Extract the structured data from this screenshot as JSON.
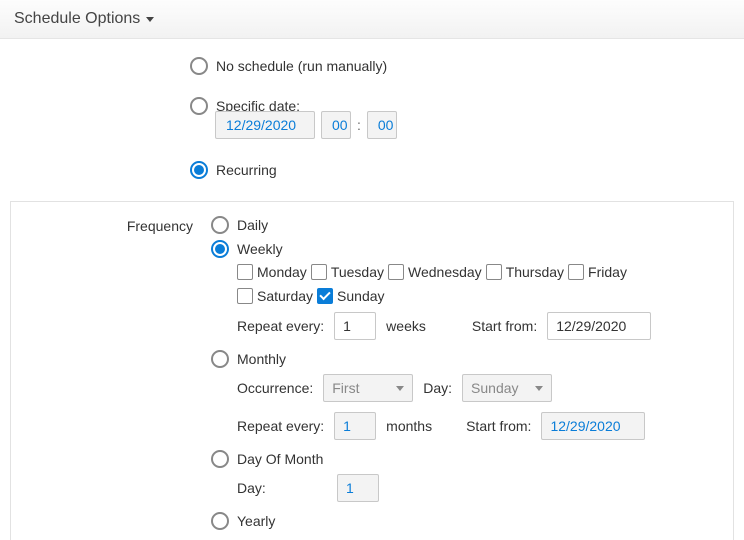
{
  "header": {
    "title": "Schedule Options"
  },
  "schedule": {
    "no_schedule_label": "No schedule (run manually)",
    "specific_date_label": "Specific date:",
    "specific_date": {
      "date": "12/29/2020",
      "hour": "00",
      "minute": "00"
    },
    "recurring_label": "Recurring"
  },
  "frequency": {
    "label": "Frequency",
    "daily_label": "Daily",
    "weekly": {
      "label": "Weekly",
      "days": {
        "monday": "Monday",
        "tuesday": "Tuesday",
        "wednesday": "Wednesday",
        "thursday": "Thursday",
        "friday": "Friday",
        "saturday": "Saturday",
        "sunday": "Sunday"
      },
      "repeat_label": "Repeat every:",
      "repeat_value": "1",
      "repeat_unit": "weeks",
      "start_label": "Start from:",
      "start_value": "12/29/2020"
    },
    "monthly": {
      "label": "Monthly",
      "occurrence_label": "Occurrence:",
      "occurrence_value": "First",
      "day_label": "Day:",
      "day_value": "Sunday",
      "repeat_label": "Repeat every:",
      "repeat_value": "1",
      "repeat_unit": "months",
      "start_label": "Start from:",
      "start_value": "12/29/2020"
    },
    "day_of_month": {
      "label": "Day Of Month",
      "day_label": "Day:",
      "day_value": "1"
    },
    "yearly_label": "Yearly"
  }
}
